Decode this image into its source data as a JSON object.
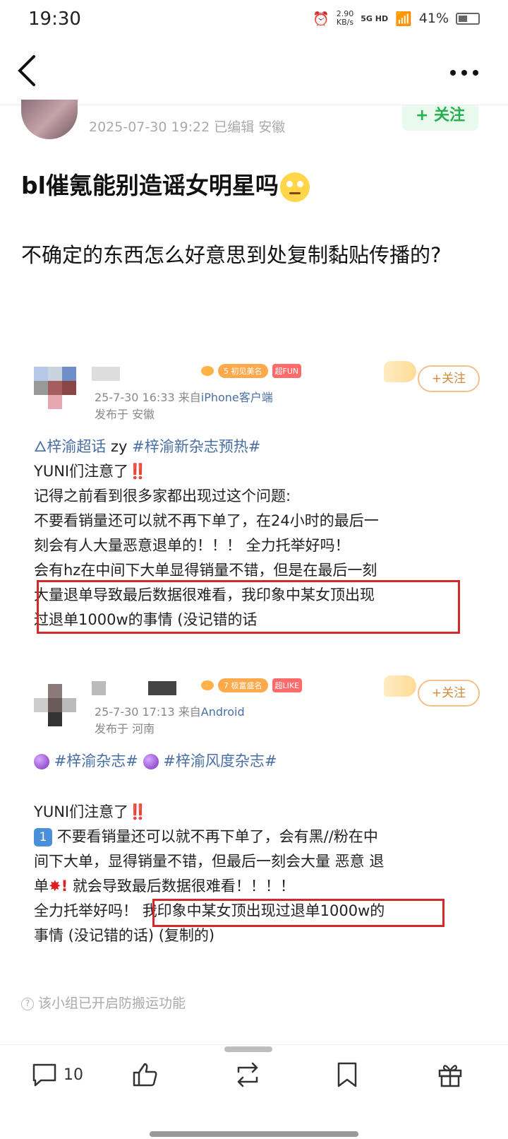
{
  "status": {
    "time": "19:30",
    "speed_top": "2.90",
    "speed_unit": "KB/s",
    "network": "5G HD",
    "battery": "41%"
  },
  "post": {
    "meta": "2025-07-30 19:22  已编辑  安徽",
    "follow_label": "+ 关注",
    "title": "bl催氪能别造谣女明星吗",
    "body": "不确定的东西怎么好意思到处复制黏贴传播的?"
  },
  "card1": {
    "badge_level": "5 初见美名",
    "badge_tag": "超FUN",
    "meta_time": "25-7-30 16:33",
    "meta_from": "来自",
    "meta_source": "iPhone客户端",
    "meta_location": "发布于 安徽",
    "follow_label": "+关注",
    "topic_line": "🜂梓渝超话",
    "topic_mid": " zy ",
    "topic_tag": "#梓渝新杂志预热#",
    "line1": "YUNI们注意了",
    "excl": "‼️",
    "line2": "记得之前看到很多家都出现过这个问题:",
    "line3": "不要看销量还可以就不再下单了，在24小时的最后一",
    "line4": "刻会有人大量恶意退单的！！！ 全力托举好吗！",
    "line5": "会有hz在中间下大单显得销量不错，但是在最后一刻",
    "line6": "大量退单导致最后数据很难看，我印象中某女顶出现",
    "line7": "过退单1000w的事情 (没记错的话"
  },
  "card2": {
    "badge_level": "7 极富盛名",
    "badge_tag": "超LIKE",
    "meta_time": "25-7-30 17:13",
    "meta_from": "来自",
    "meta_source": "Android",
    "meta_location": "发布于 河南",
    "follow_label": "+关注",
    "topic1": "#梓渝杂志#",
    "topic2": "#梓渝风度杂志#",
    "line1": "YUNI们注意了",
    "excl": "‼️",
    "num": "1",
    "line2": "不要看销量还可以就不再下单了，会有黑//粉在中",
    "line3": "间下大单，显得销量不错，但最后一刻会大量 恶意 退",
    "line4a": "单",
    "line4b": "就会导致最后数据很难看！！！！",
    "line5a": "全力托举好吗！",
    "line5b": "我印象中某女顶出现过退单1000w的",
    "line6": "事情 (没记错的话) (复制的)"
  },
  "anti_note": "该小组已开启防搬运功能",
  "bottom": {
    "comment_count": "10"
  }
}
